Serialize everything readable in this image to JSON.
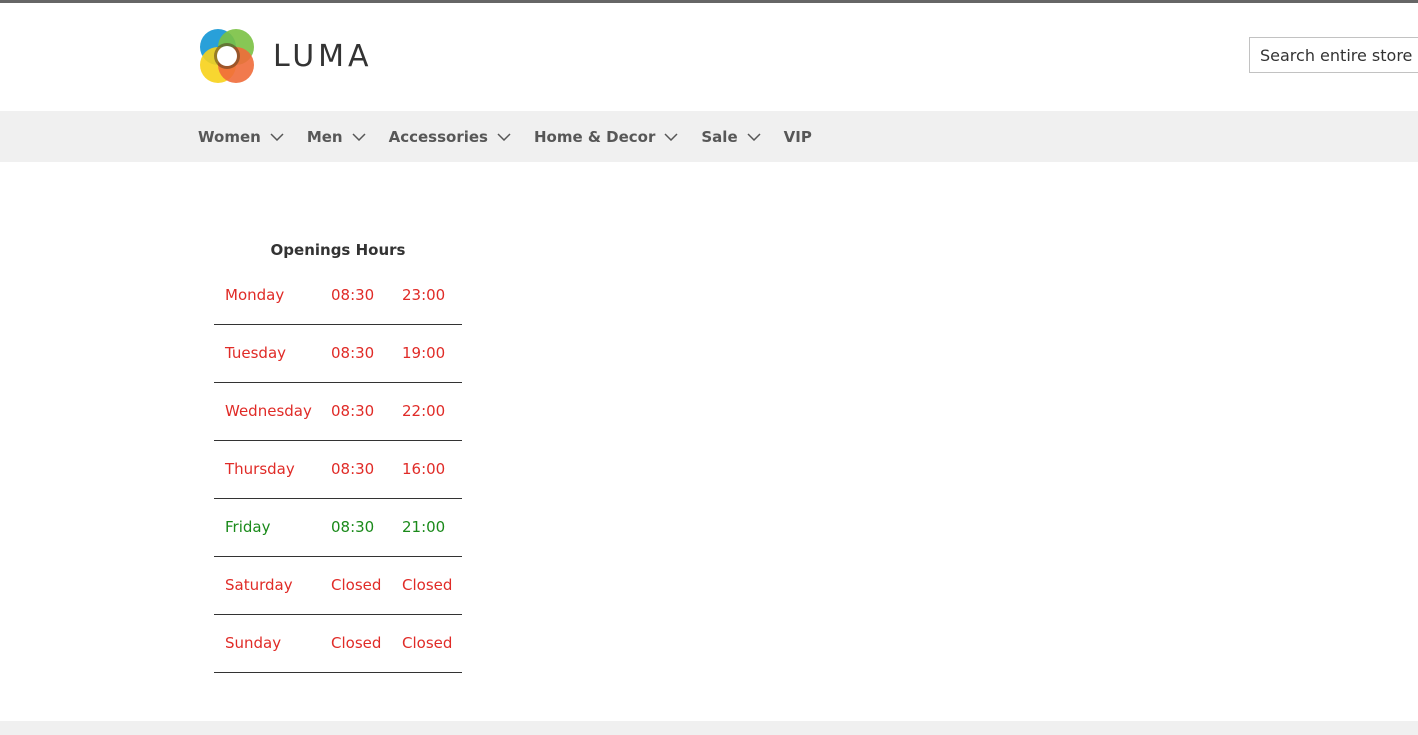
{
  "header": {
    "logo_text": "LUMA",
    "search": {
      "placeholder": "Search entire store here..."
    }
  },
  "nav": {
    "items": [
      {
        "label": "Women",
        "has_dropdown": true
      },
      {
        "label": "Men",
        "has_dropdown": true
      },
      {
        "label": "Accessories",
        "has_dropdown": true
      },
      {
        "label": "Home & Decor",
        "has_dropdown": true
      },
      {
        "label": "Sale",
        "has_dropdown": true
      },
      {
        "label": "VIP",
        "has_dropdown": false
      }
    ]
  },
  "hours": {
    "title": "Openings Hours",
    "rows": [
      {
        "day": "Monday",
        "open": "08:30",
        "close": "23:00",
        "status": "red"
      },
      {
        "day": "Tuesday",
        "open": "08:30",
        "close": "19:00",
        "status": "red"
      },
      {
        "day": "Wednesday",
        "open": "08:30",
        "close": "22:00",
        "status": "red"
      },
      {
        "day": "Thursday",
        "open": "08:30",
        "close": "16:00",
        "status": "red"
      },
      {
        "day": "Friday",
        "open": "08:30",
        "close": "21:00",
        "status": "green"
      },
      {
        "day": "Saturday",
        "open": "Closed",
        "close": "Closed",
        "status": "red"
      },
      {
        "day": "Sunday",
        "open": "Closed",
        "close": "Closed",
        "status": "red"
      }
    ]
  },
  "colors": {
    "closed_or_other_day": "#e02b27",
    "current_day": "#1a8a1a",
    "nav_background": "#f0f0f0"
  }
}
